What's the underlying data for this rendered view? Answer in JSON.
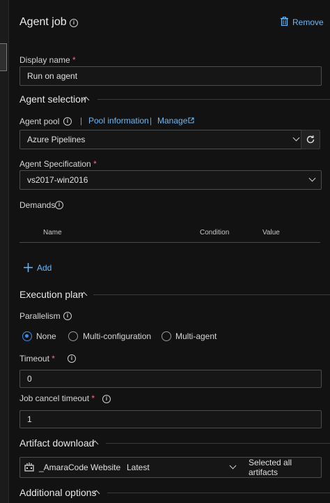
{
  "header": {
    "title": "Agent job",
    "remove_label": "Remove"
  },
  "display_name": {
    "label": "Display name",
    "required_mark": "*",
    "value": "Run on agent"
  },
  "agent_selection": {
    "heading": "Agent selection",
    "pool_label": "Agent pool",
    "separator": "|",
    "pool_info_link": "Pool information",
    "manage_link": "Manage",
    "pool_value": "Azure Pipelines",
    "spec_label": "Agent Specification",
    "spec_value": "vs2017-win2016",
    "demands_label": "Demands",
    "columns": [
      "Name",
      "Condition",
      "Value"
    ],
    "add_label": "Add"
  },
  "execution_plan": {
    "heading": "Execution plan",
    "parallelism_label": "Parallelism",
    "options": [
      "None",
      "Multi-configuration",
      "Multi-agent"
    ],
    "selected": "None",
    "timeout_label": "Timeout",
    "timeout_value": "0",
    "cancel_label": "Job cancel timeout",
    "cancel_value": "1"
  },
  "artifact_download": {
    "heading": "Artifact download",
    "artifact_name": "_AmaraCode Website",
    "version": "Latest",
    "selection": "Selected all artifacts"
  },
  "additional_options": {
    "heading": "Additional options"
  },
  "colors": {
    "accent": "#3b8fe3",
    "link": "#6cb8f6",
    "required": "#f1707b",
    "background": "#121212"
  }
}
